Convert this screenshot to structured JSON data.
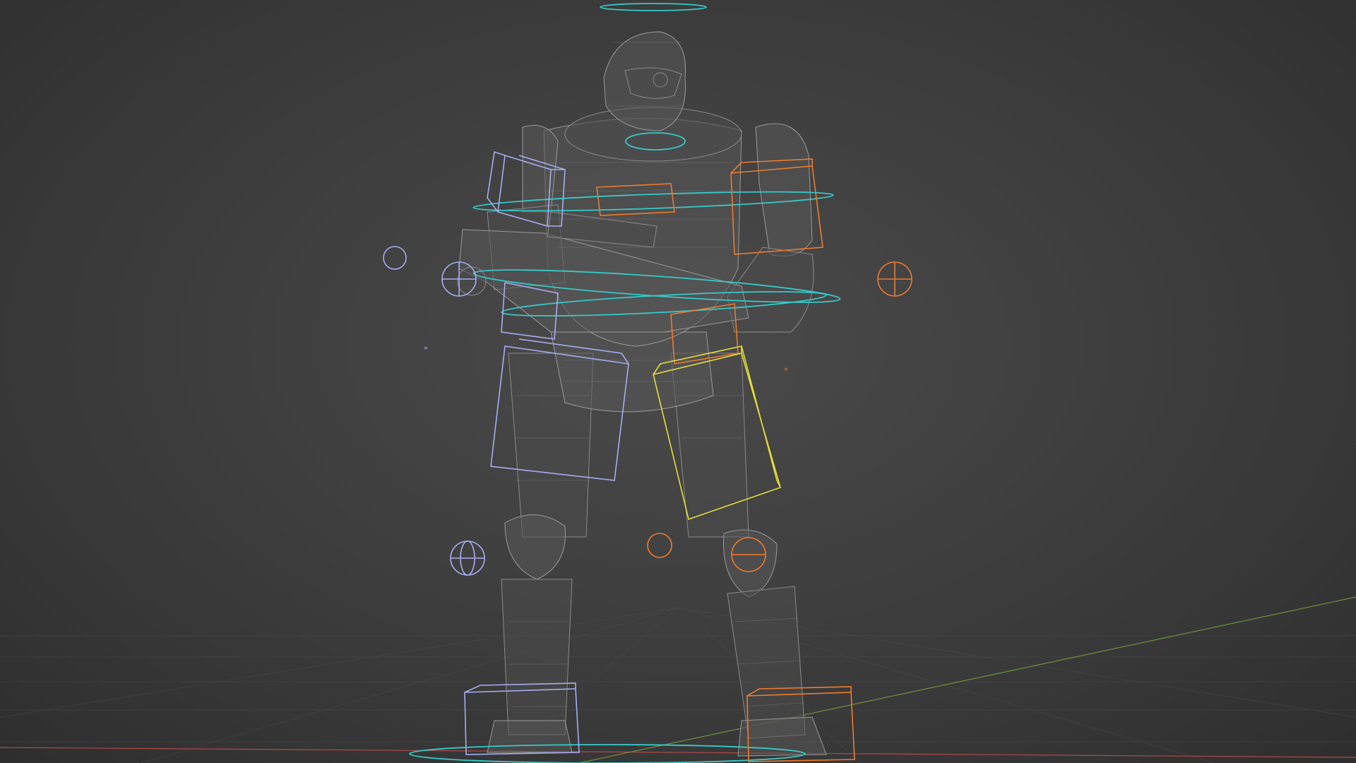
{
  "viewport": {
    "background": "#404040",
    "grid_color": "#4c4c4c",
    "x_axis_color": "#b04a4a",
    "y_axis_color": "#6f8f3a"
  },
  "model": {
    "shading": "wireframe",
    "mesh_color": "#9a9a9a"
  },
  "rig": {
    "left_controls_color": "#a6adf0",
    "right_controls_color": "#ef7b2d",
    "center_controls_color": "#37c9c9",
    "selected_control_color": "#e3df3a"
  }
}
